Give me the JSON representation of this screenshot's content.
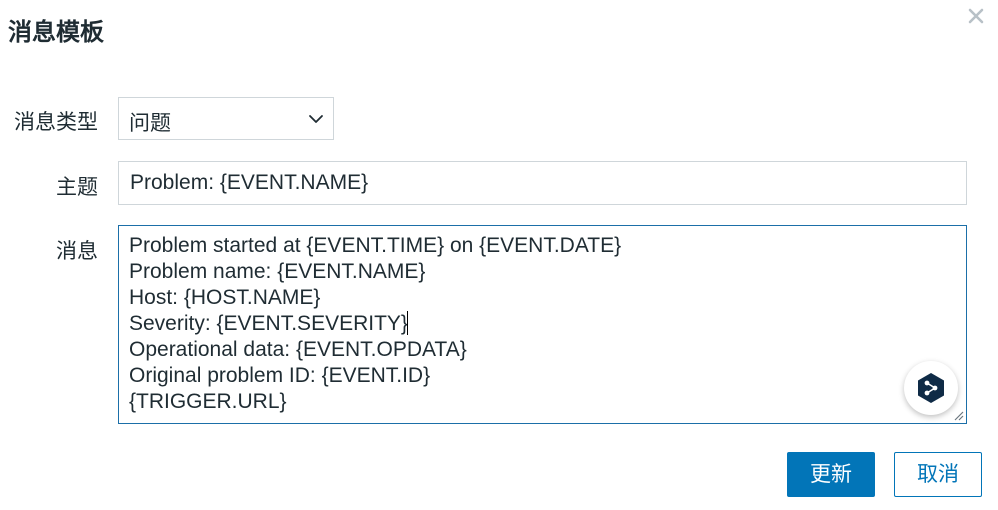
{
  "dialog": {
    "title": "消息模板",
    "close_icon": "close-icon"
  },
  "form": {
    "message_type": {
      "label": "消息类型",
      "selected": "问题"
    },
    "subject": {
      "label": "主题",
      "value": "Problem: {EVENT.NAME}"
    },
    "message": {
      "label": "消息",
      "lines": [
        "Problem started at {EVENT.TIME} on {EVENT.DATE}",
        "Problem name: {EVENT.NAME}",
        "Host: {HOST.NAME}",
        "Severity: {EVENT.SEVERITY}",
        "Operational data: {EVENT.OPDATA}",
        "Original problem ID: {EVENT.ID}",
        "{TRIGGER.URL}"
      ]
    }
  },
  "floating_button_icon": "deepl-translate-icon",
  "buttons": {
    "update_label": "更新",
    "cancel_label": "取消"
  },
  "colors": {
    "primary": "#0275b8",
    "focus_border": "#1b6fa8",
    "text": "#1f2c33"
  }
}
